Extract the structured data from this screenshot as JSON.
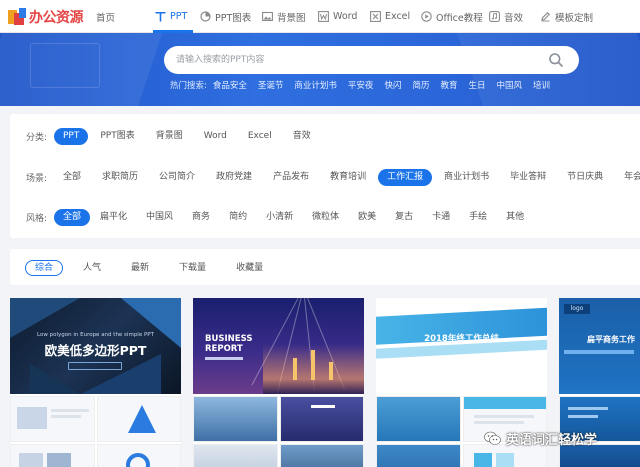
{
  "brand": {
    "logo_text": "办公资源"
  },
  "nav": {
    "items": [
      {
        "label": "首页",
        "icon": ""
      },
      {
        "label": "PPT",
        "icon": "ppt-icon"
      },
      {
        "label": "PPT图表",
        "icon": "chart-icon"
      },
      {
        "label": "背景图",
        "icon": "image-icon"
      },
      {
        "label": "Word",
        "icon": "word-icon"
      },
      {
        "label": "Excel",
        "icon": "excel-icon"
      },
      {
        "label": "Office教程",
        "icon": "play-icon"
      },
      {
        "label": "音效",
        "icon": "music-icon"
      },
      {
        "label": "模板定制",
        "icon": "edit-icon"
      }
    ],
    "active": "PPT",
    "accent": "#1a73e8"
  },
  "search": {
    "placeholder": "请输入搜索的PPT内容",
    "hot_label": "热门搜索:",
    "hot": [
      "食品安全",
      "圣诞节",
      "商业计划书",
      "平安夜",
      "快闪",
      "简历",
      "教育",
      "生日",
      "中国风",
      "培训"
    ]
  },
  "filters": {
    "category": {
      "label": "分类:",
      "items": [
        "PPT",
        "PPT图表",
        "背景图",
        "Word",
        "Excel",
        "音效"
      ],
      "selected": "PPT"
    },
    "scene": {
      "label": "场景:",
      "items": [
        "全部",
        "求职简历",
        "公司简介",
        "政府党建",
        "产品发布",
        "教育培训",
        "工作汇报",
        "商业计划书",
        "毕业答辩",
        "节日庆典",
        "年会颁奖"
      ],
      "selected": "工作汇报"
    },
    "style": {
      "label": "风格:",
      "items": [
        "全部",
        "扁平化",
        "中国风",
        "商务",
        "简约",
        "小清新",
        "微粒体",
        "欧美",
        "复古",
        "卡通",
        "手绘",
        "其他"
      ],
      "selected": "全部"
    }
  },
  "sort": {
    "items": [
      "综合",
      "人气",
      "最新",
      "下载量",
      "收藏量"
    ],
    "selected": "综合"
  },
  "thumbnails": [
    {
      "title": "欧美低多边形PPT",
      "subtitle": "Low polygon in Europe and the simple PPT"
    },
    {
      "title_line1": "BUSINESS",
      "title_line2": "REPORT"
    },
    {
      "title": "2018年终工作总结"
    },
    {
      "logo": "logo",
      "title": "扁平商务工作"
    }
  ],
  "watermark": {
    "text": "英语词汇轻松学",
    "icon": "wechat-icon"
  }
}
